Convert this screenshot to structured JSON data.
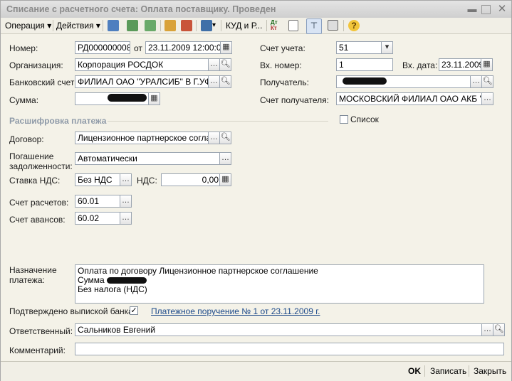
{
  "window": {
    "title": "Списание с расчетного счета: Оплата поставщику. Проведен"
  },
  "toolbar": {
    "operation_label": "Операция",
    "actions_label": "Действия",
    "kud_label": "КУД и Р..."
  },
  "form": {
    "number_label": "Номер:",
    "number_value": "РД000000008",
    "from_label": "от",
    "date_value": "23.11.2009 12:00:00",
    "account_label": "Счет учета:",
    "account_value": "51",
    "org_label": "Организация:",
    "org_value": "Корпорация РОСДОК",
    "in_number_label": "Вх. номер:",
    "in_number_value": "1",
    "in_date_label": "Вх. дата:",
    "in_date_value": "23.11.2009",
    "bank_account_label": "Банковский счет:",
    "bank_account_value": "ФИЛИАЛ ОАО \"УРАЛСИБ\" В Г.УФА",
    "recipient_label": "Получатель:",
    "sum_label": "Сумма:",
    "recipient_account_label": "Счет получателя:",
    "recipient_account_value": "МОСКОВСКИЙ ФИЛИАЛ ОАО АКБ \"РОСБАНК\"",
    "section_title": "Расшифровка платежа",
    "list_label": "Список",
    "contract_label": "Договор:",
    "contract_value": "Лицензионное партнерское соглашение",
    "debt_label_1": "Погашение",
    "debt_label_2": "задолженности:",
    "debt_value": "Автоматически",
    "vat_rate_label": "Ставка НДС:",
    "vat_rate_value": "Без НДС",
    "vat_label": "НДС:",
    "vat_value": "0,00",
    "settle_account_label": "Счет расчетов:",
    "settle_account_value": "60.01",
    "advance_account_label": "Счет авансов:",
    "advance_account_value": "60.02",
    "purpose_label_1": "Назначение",
    "purpose_label_2": "платежа:",
    "purpose_line1": "Оплата по договору Лицензионное партнерское соглашение",
    "purpose_line2": "Сумма",
    "purpose_line3": "Без налога (НДС)",
    "confirmed_label": "Подтверждено выпиской банка",
    "payment_link": "Платежное поручение № 1 от 23.11.2009 г.",
    "responsible_label": "Ответственный:",
    "responsible_value": "Сальников Евгений",
    "comment_label": "Комментарий:",
    "comment_value": ""
  },
  "buttons": {
    "ok": "OK",
    "save": "Записать",
    "close": "Закрыть"
  },
  "colors": {
    "section": "#8e9aa8",
    "link": "#1d4a8a",
    "title": "#8a8a8a"
  }
}
